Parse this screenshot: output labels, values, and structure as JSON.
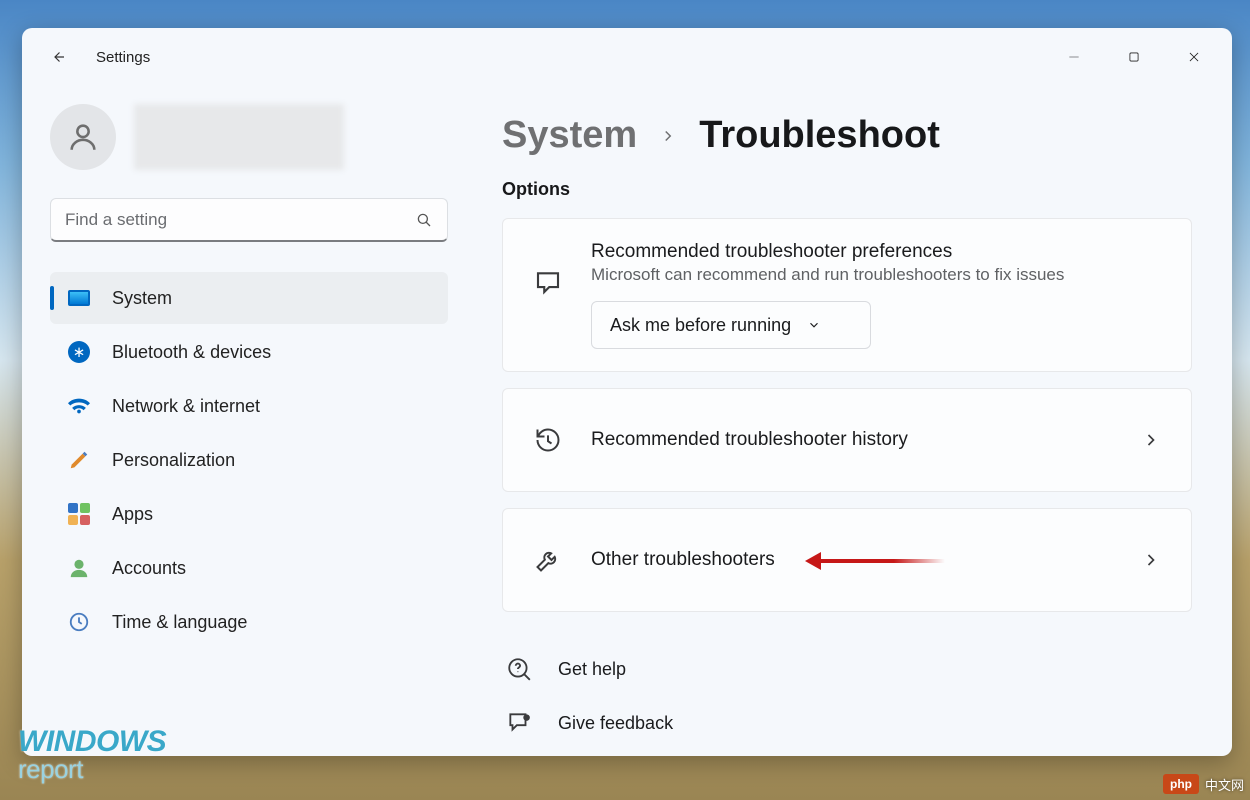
{
  "window": {
    "title": "Settings",
    "breadcrumb_parent": "System",
    "breadcrumb_current": "Troubleshoot"
  },
  "search": {
    "placeholder": "Find a setting"
  },
  "sidebar": {
    "items": [
      {
        "label": "System"
      },
      {
        "label": "Bluetooth & devices"
      },
      {
        "label": "Network & internet"
      },
      {
        "label": "Personalization"
      },
      {
        "label": "Apps"
      },
      {
        "label": "Accounts"
      },
      {
        "label": "Time & language"
      }
    ]
  },
  "main": {
    "options_label": "Options",
    "recommended_card": {
      "title": "Recommended troubleshooter preferences",
      "subtitle": "Microsoft can recommend and run troubleshooters to fix issues",
      "dropdown_selected": "Ask me before running"
    },
    "history_card": {
      "title": "Recommended troubleshooter history"
    },
    "other_card": {
      "title": "Other troubleshooters"
    },
    "help": {
      "get_help": "Get help",
      "give_feedback": "Give feedback"
    }
  },
  "watermark": {
    "line1": "WINDOWS",
    "line2": "report"
  },
  "badge": {
    "pill": "php",
    "text": "中文网"
  }
}
